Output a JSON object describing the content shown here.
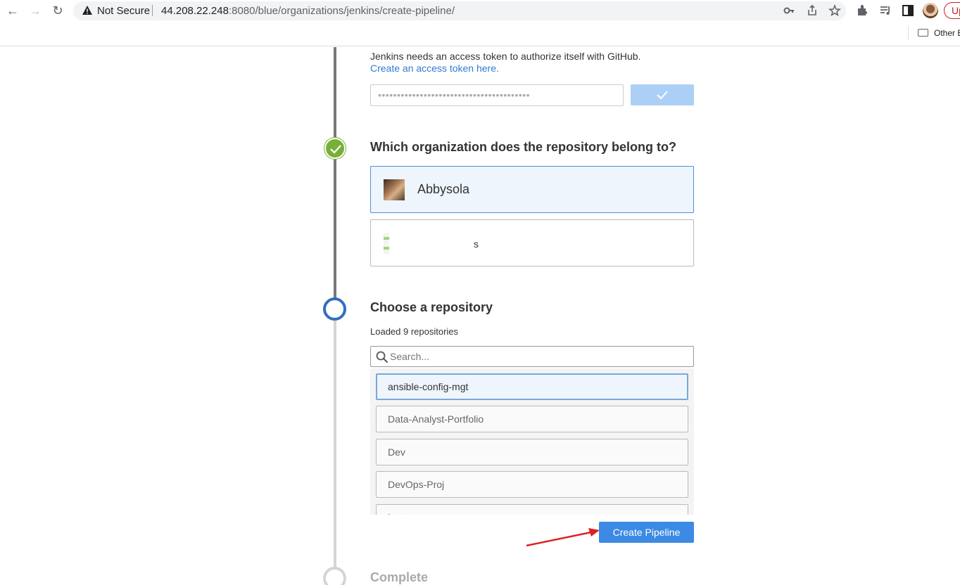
{
  "browser": {
    "security_label": "Not Secure",
    "url_host": "44.208.22.248",
    "url_path": ":8080/blue/organizations/jenkins/create-pipeline/",
    "update_label": "Up",
    "bookmark_other": "Other B"
  },
  "github_token": {
    "help_text": "Jenkins needs an access token to authorize itself with GitHub.",
    "link_text": "Create an access token here.",
    "masked_value": "••••••••••••••••••••••••••••••••••••••••"
  },
  "organization_step": {
    "heading": "Which organization does the repository belong to?",
    "organizations": [
      {
        "name": "Abbysola",
        "selected": true
      },
      {
        "name": "s",
        "selected": false
      }
    ]
  },
  "repository_step": {
    "heading": "Choose a repository",
    "loaded_text": "Loaded 9 repositories",
    "search_placeholder": "Search...",
    "repositories": [
      {
        "name": "ansible-config-mgt",
        "selected": true
      },
      {
        "name": "Data-Analyst-Portfolio",
        "selected": false
      },
      {
        "name": "Dev",
        "selected": false
      },
      {
        "name": "DevOps-Proj",
        "selected": false
      },
      {
        "name": "hostsee",
        "selected": false
      }
    ],
    "create_button": "Create Pipeline"
  },
  "complete_step": {
    "heading": "Complete"
  },
  "colors": {
    "accent": "#3c8ae3",
    "success": "#78b037",
    "current_step": "#316fbe",
    "arrow": "#e02020"
  }
}
